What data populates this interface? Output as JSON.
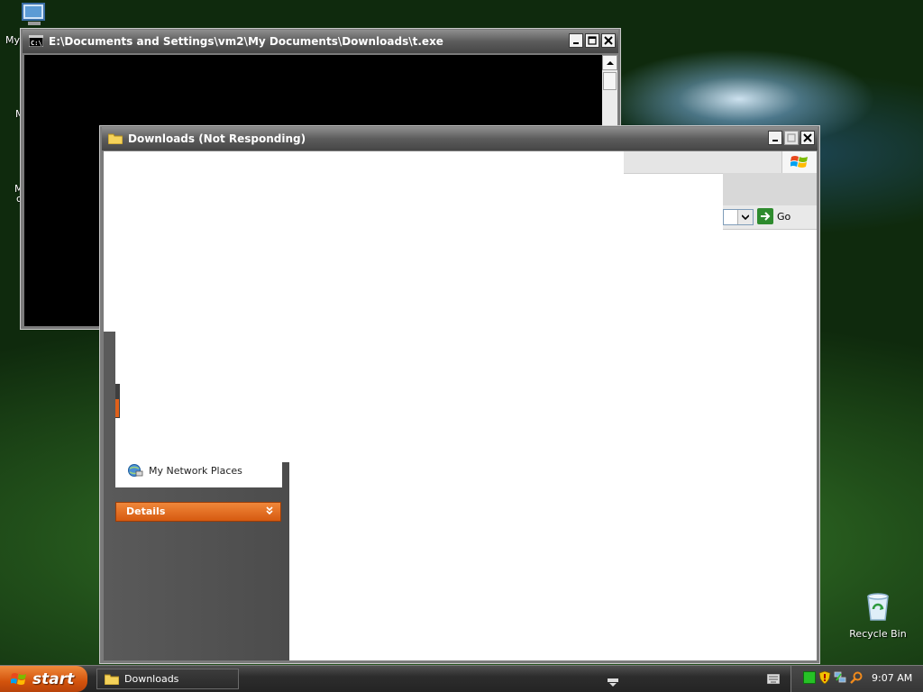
{
  "desktop": {
    "icons": [
      {
        "name": "my-computer",
        "label_fragment": "My"
      },
      {
        "name": "recycle-bin",
        "label": "Recycle Bin"
      }
    ],
    "clipped_labels": [
      "M",
      "M",
      "c"
    ]
  },
  "cmd_window": {
    "title": "E:\\Documents and Settings\\vm2\\My Documents\\Downloads\\t.exe",
    "icon": "console-icon"
  },
  "explorer_window": {
    "title": "Downloads (Not Responding)",
    "icon": "folder-icon",
    "address_go_label": "Go",
    "other_places": [
      {
        "label": "My Network Places",
        "icon": "network-places-icon"
      }
    ],
    "details_label": "Details"
  },
  "taskbar": {
    "start_label": "start",
    "task_buttons": [
      {
        "label": "Downloads",
        "icon": "folder-icon"
      }
    ],
    "tray": {
      "icons": [
        "green-status-icon",
        "security-shield-icon",
        "network-icon",
        "search-icon"
      ],
      "clock": "9:07 AM"
    }
  },
  "colors": {
    "accent_orange": "#d65a10",
    "titlebar_gray": "#5c5c5c",
    "tray_green": "#26c226"
  }
}
